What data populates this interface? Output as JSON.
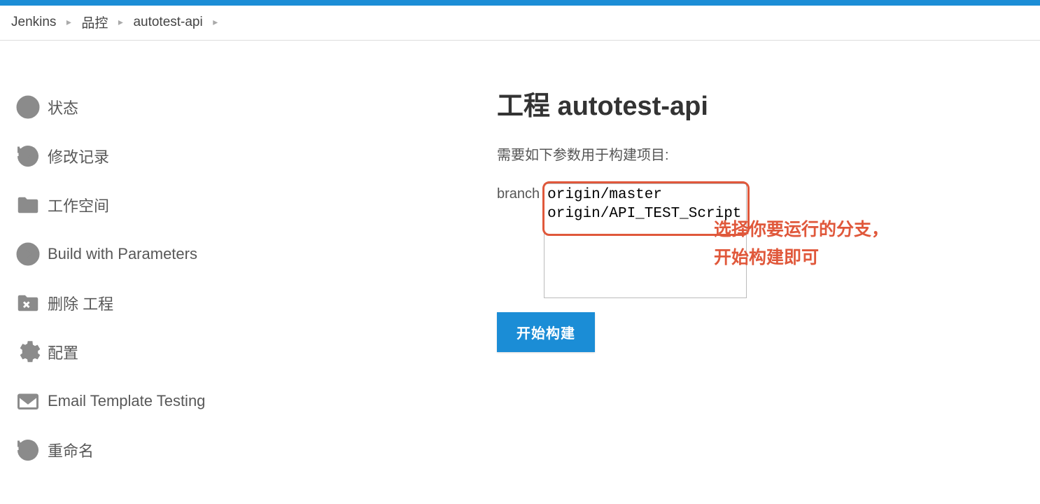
{
  "breadcrumb": {
    "items": [
      "Jenkins",
      "品控",
      "autotest-api"
    ]
  },
  "sidebar": {
    "items": [
      {
        "id": "status",
        "label": "状态",
        "icon": "info"
      },
      {
        "id": "changes",
        "label": "修改记录",
        "icon": "history"
      },
      {
        "id": "workspace",
        "label": "工作空间",
        "icon": "folder"
      },
      {
        "id": "build-params",
        "label": "Build with Parameters",
        "icon": "play"
      },
      {
        "id": "delete",
        "label": "删除 工程",
        "icon": "folder-x"
      },
      {
        "id": "configure",
        "label": "配置",
        "icon": "gear"
      },
      {
        "id": "email-test",
        "label": "Email Template Testing",
        "icon": "envelope"
      },
      {
        "id": "rename",
        "label": "重命名",
        "icon": "history"
      }
    ]
  },
  "main": {
    "title": "工程 autotest-api",
    "subtitle": "需要如下参数用于构建项目:",
    "param_label": "branch",
    "branch_options": [
      "origin/master",
      "origin/API_TEST_Script"
    ],
    "build_button_label": "开始构建"
  },
  "annotations": {
    "line1": "选择你要运行的分支，",
    "line2": "开始构建即可"
  }
}
